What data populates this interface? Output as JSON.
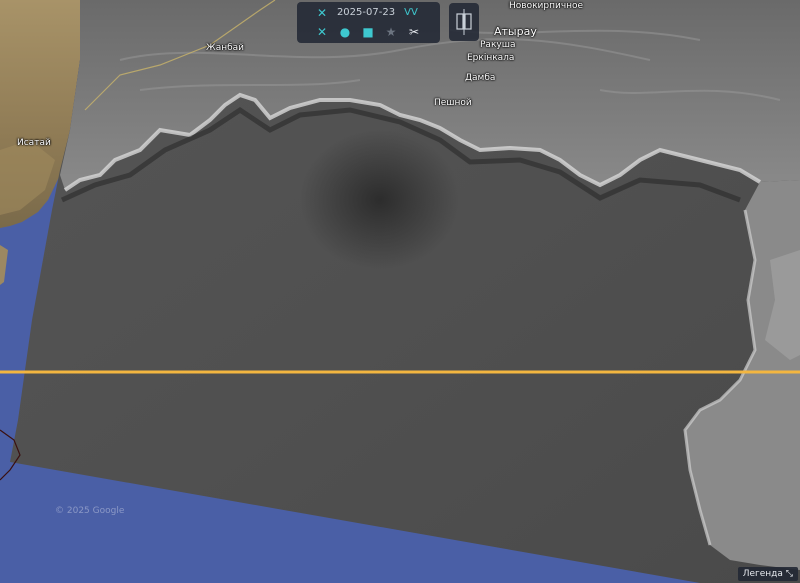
{
  "toolbar": {
    "date": "2025-07-23",
    "polarization": "VV",
    "icons": [
      "satellite-icon",
      "satellite-icon",
      "map-pin-icon",
      "camera-icon",
      "star-icon",
      "scissors-icon"
    ]
  },
  "places": {
    "novokirpichnoe": "Новокирпичное",
    "atyrau": "Атырау",
    "rakusha": "Ракуша",
    "erkinkala": "Еркінкала",
    "damba": "Дамба",
    "peshnoy": "Пешной",
    "zhanbai": "Жанбай",
    "isatai": "Исатай"
  },
  "copyright": "© 2025 Google",
  "legend_label": "Легенда",
  "colors": {
    "sea": "#4a5fa6",
    "toolbar_bg": "#222834",
    "accent": "#3ec8cf",
    "orbit_line": "#f3b640"
  }
}
